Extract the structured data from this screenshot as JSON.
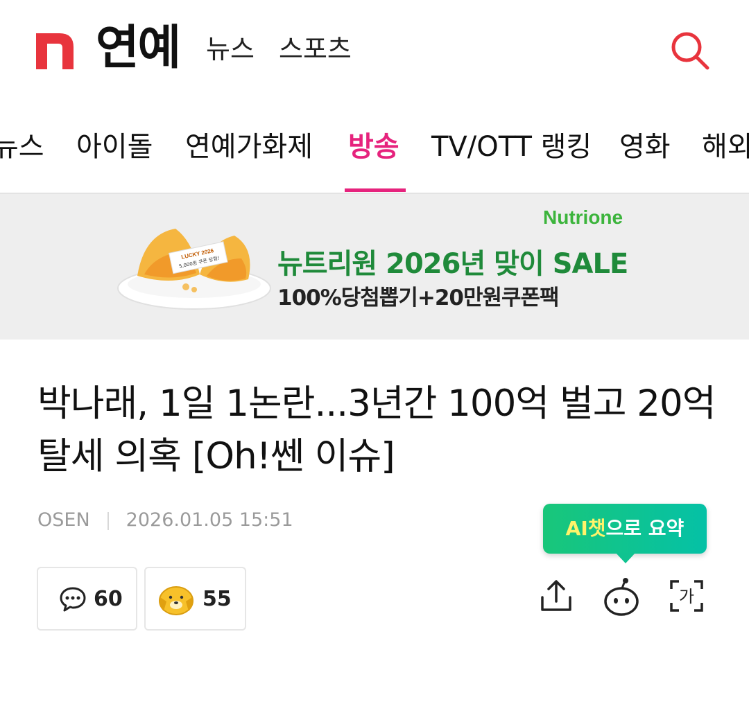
{
  "header": {
    "logo_letter": "n",
    "section_title": "연예",
    "links": [
      "뉴스",
      "스포츠"
    ],
    "brand_color": "#e8343d"
  },
  "tabs": {
    "items": [
      "뉴스",
      "아이돌",
      "연예가화제",
      "방송",
      "TV/OTT 랭킹",
      "영화",
      "해외"
    ],
    "active": "방송",
    "active_color": "#e6237d"
  },
  "ad": {
    "brand": "Nutrione",
    "headline": "뉴트리원 2026년 맞이 SALE",
    "subline": "100%당첨뽑기+20만원쿠폰팩",
    "cookie_note_line1": "LUCKY 2026",
    "cookie_note_line2": "5,000원 쿠폰 당첨!"
  },
  "article": {
    "title": "박나래, 1일 1논란...3년간 100억 벌고 20억 탈세 의혹 [Oh!쎈 이슈]",
    "source": "OSEN",
    "datetime": "2026.01.05 15:51"
  },
  "ai_summary": {
    "label_highlight": "AI챗",
    "label_rest": "으로 요약"
  },
  "reactions": {
    "comments": "60",
    "likes": "55"
  },
  "toolbar": {
    "font_size_glyph": "가"
  }
}
